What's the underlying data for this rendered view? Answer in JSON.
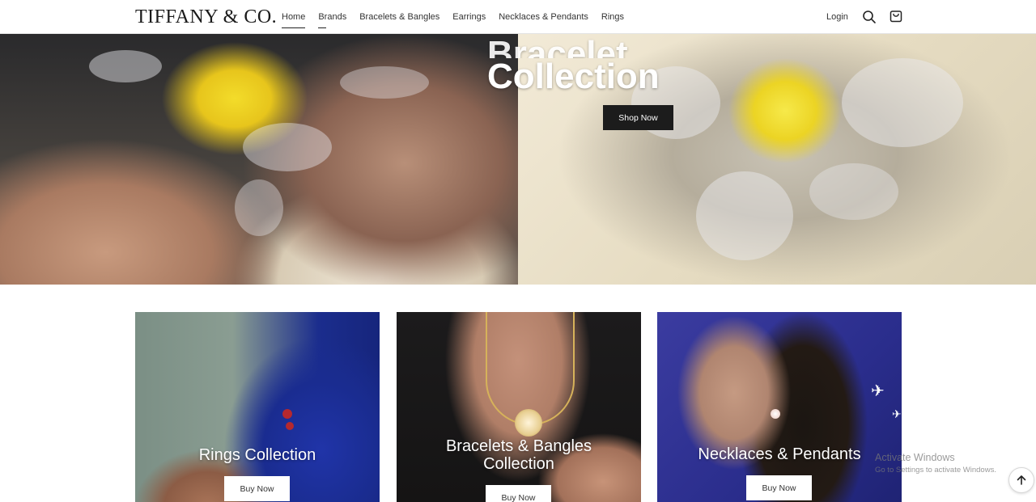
{
  "brand": {
    "logo_text": "TIFFANY & CO."
  },
  "nav": {
    "items": [
      {
        "label": "Home"
      },
      {
        "label": "Brands"
      },
      {
        "label": "Bracelets & Bangles"
      },
      {
        "label": "Earrings"
      },
      {
        "label": "Necklaces & Pendants"
      },
      {
        "label": "Rings"
      }
    ],
    "login": "Login",
    "icons": [
      "search-icon",
      "shopping-bag-icon"
    ]
  },
  "hero": {
    "title_line1": "Bracelet",
    "title_line2": "Collection",
    "button": "Shop Now"
  },
  "cards": [
    {
      "title": "Rings Collection",
      "button": "Buy Now"
    },
    {
      "title_line1": "Bracelets & Bangles",
      "title_line2": "Collection",
      "button": "Buy Now"
    },
    {
      "title": "Necklaces & Pendants",
      "button": "Buy Now"
    }
  ],
  "watermark": {
    "line1": "Activate Windows",
    "line2": "Go to Settings to activate Windows."
  },
  "colors": {
    "accent": "#1c1c1c",
    "header_bg": "#ffffff"
  }
}
